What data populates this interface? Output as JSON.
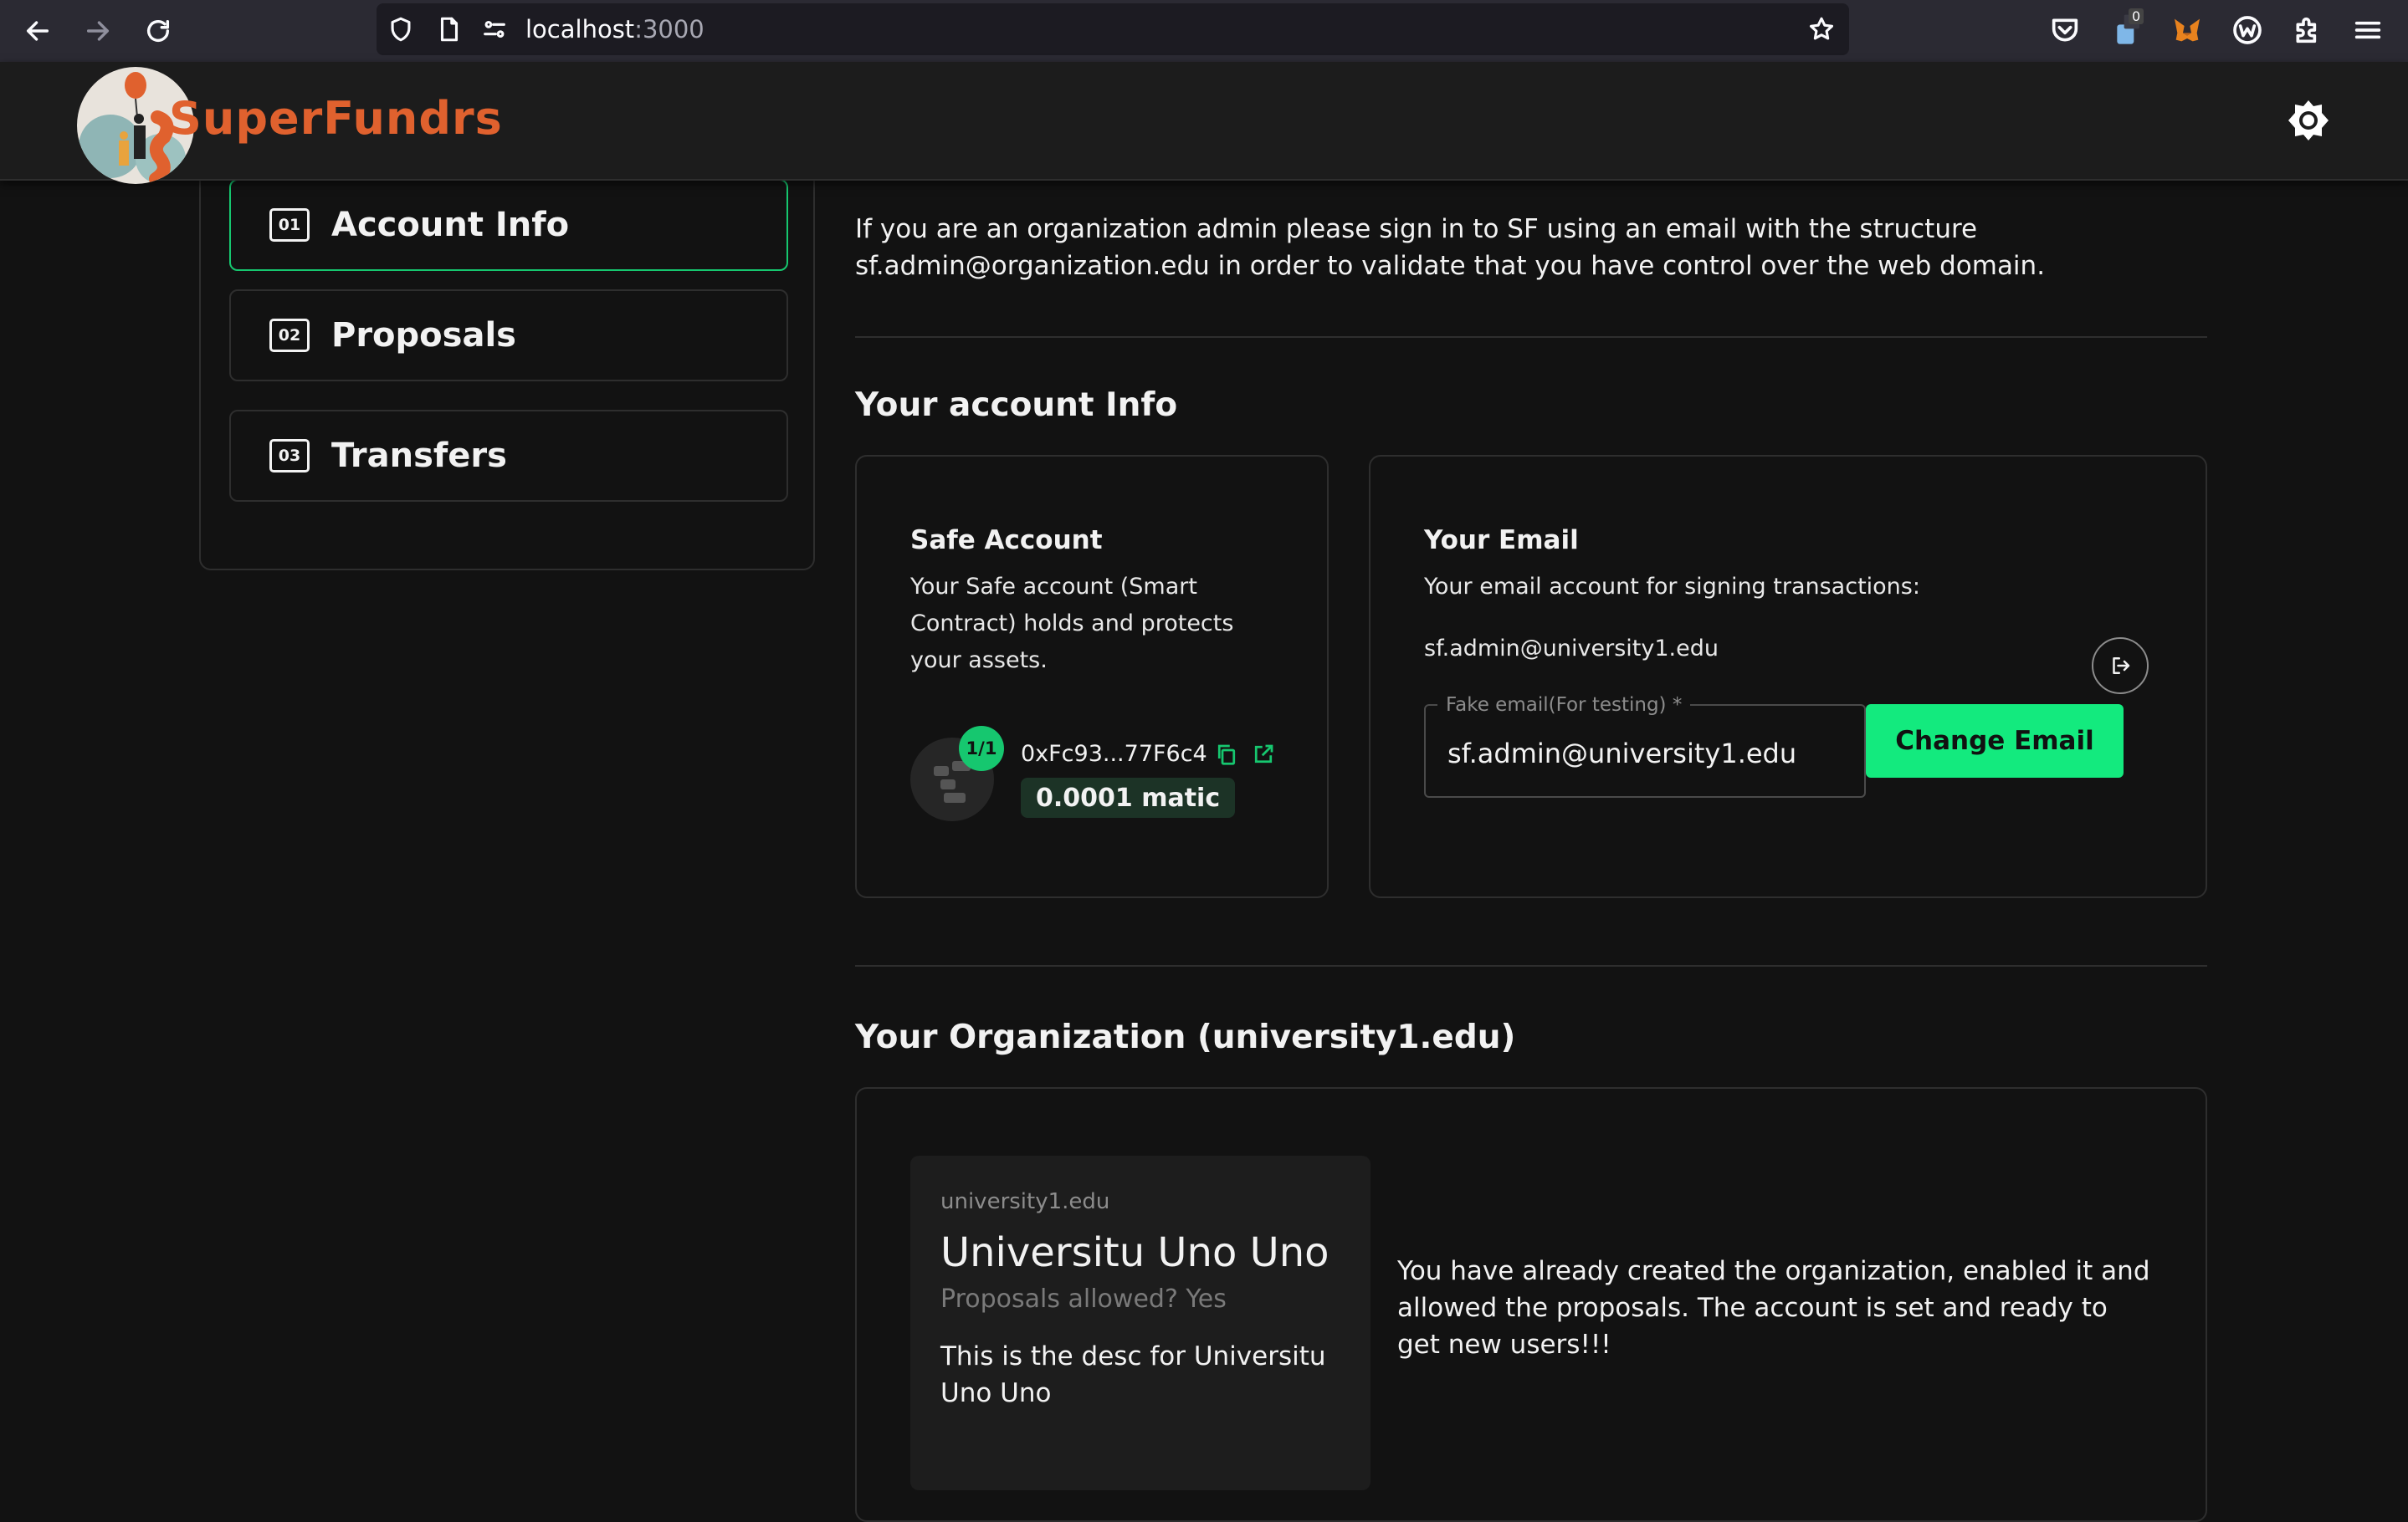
{
  "browser": {
    "url_host": "localhost",
    "url_port": ":3000",
    "extension_badge": "0"
  },
  "header": {
    "logo_text": "SuperFundrs"
  },
  "sidebar": {
    "items": [
      {
        "num": "01",
        "label": "Account Info",
        "active": true
      },
      {
        "num": "02",
        "label": "Proposals",
        "active": false
      },
      {
        "num": "03",
        "label": "Transfers",
        "active": false
      }
    ]
  },
  "main": {
    "intro": "If you are an organization admin please sign in to SF using an email with the structure sf.admin@organization.edu in order to validate that you have control over the web domain.",
    "account_section_title": "Your account Info",
    "safe_card": {
      "title": "Safe Account",
      "description": "Your Safe account (Smart Contract) holds and protects your assets.",
      "threshold": "1/1",
      "address": "0xFc93...77F6c4",
      "balance": "0.0001 matic"
    },
    "email_card": {
      "title": "Your Email",
      "description": "Your email account for signing transactions:",
      "current_email": "sf.admin@university1.edu",
      "field_label": "Fake email(For testing) *",
      "field_value": "sf.admin@university1.edu",
      "change_button": "Change Email"
    },
    "org_section_title": "Your Organization (university1.edu)",
    "org_card": {
      "domain": "university1.edu",
      "name": "Universitu Uno Uno",
      "proposals_allowed": "Proposals allowed? Yes",
      "description": "This is the desc for Universitu Uno Uno",
      "status_message": "You have already created the organization, enabled it and allowed the proposals. The account is set and ready to get new users!!!"
    }
  },
  "colors": {
    "accent": "#16c76f",
    "button": "#13ea7e",
    "background": "#121212",
    "brand": "#e0612e"
  }
}
